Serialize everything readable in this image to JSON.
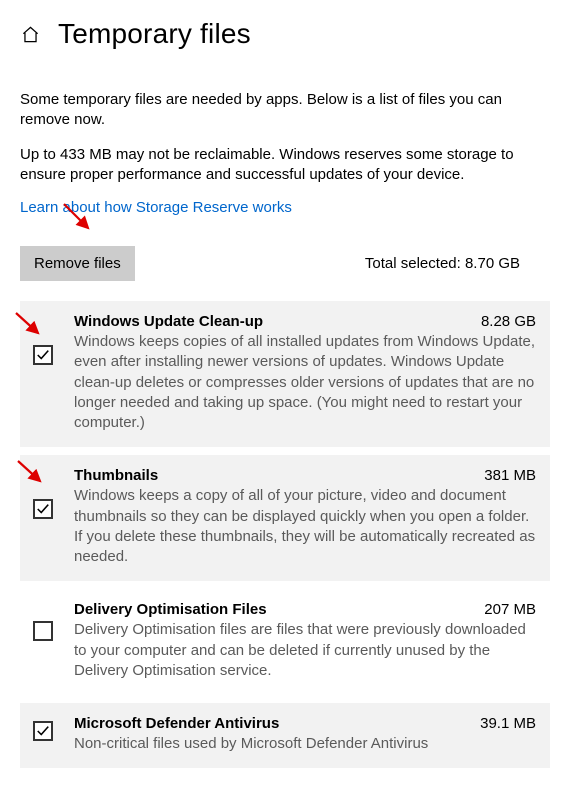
{
  "header": {
    "title": "Temporary files"
  },
  "intro": {
    "p1": "Some temporary files are needed by apps. Below is a list of files you can remove now.",
    "p2": "Up to 433 MB may not be reclaimable. Windows reserves some storage to ensure proper performance and successful updates of your device.",
    "link": "Learn about how Storage Reserve works"
  },
  "actions": {
    "remove_label": "Remove files",
    "total_label": "Total selected: 8.70 GB"
  },
  "items": [
    {
      "name": "Windows Update Clean-up",
      "size": "8.28 GB",
      "desc": "Windows keeps copies of all installed updates from Windows Update, even after installing newer versions of updates. Windows Update clean-up deletes or compresses older versions of updates that are no longer needed and taking up space. (You might need to restart your computer.)",
      "checked": true
    },
    {
      "name": "Thumbnails",
      "size": "381 MB",
      "desc": "Windows keeps a copy of all of your picture, video and document thumbnails so they can be displayed quickly when you open a folder. If you delete these thumbnails, they will be automatically recreated as needed.",
      "checked": true
    },
    {
      "name": "Delivery Optimisation Files",
      "size": "207 MB",
      "desc": "Delivery Optimisation files are files that were previously downloaded to your computer and can be deleted if currently unused by the Delivery Optimisation service.",
      "checked": false
    },
    {
      "name": "Microsoft Defender Antivirus",
      "size": "39.1 MB",
      "desc": "Non-critical files used by Microsoft Defender Antivirus",
      "checked": true
    }
  ]
}
